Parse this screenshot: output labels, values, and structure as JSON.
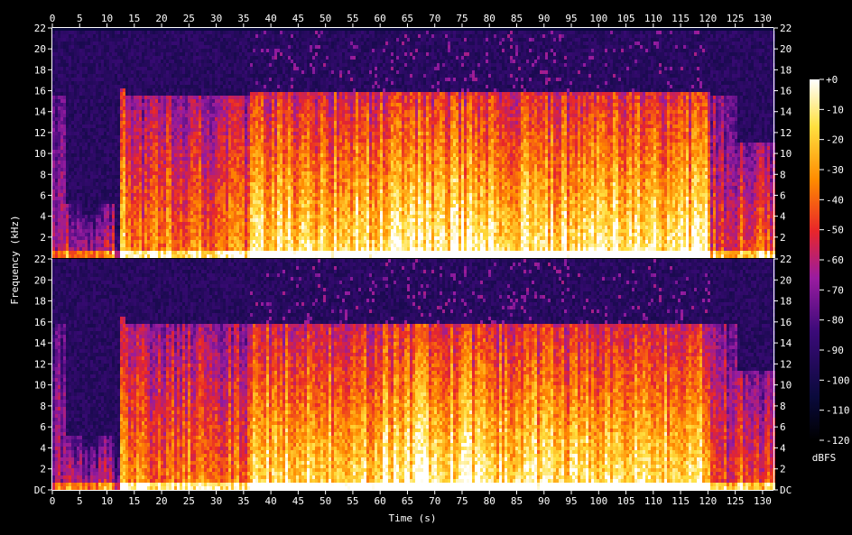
{
  "chart_data": {
    "type": "heatmap",
    "subtype": "spectrogram",
    "channels": 2,
    "xlabel": "Time (s)",
    "ylabel": "Frequency (kHz)",
    "x_range": [
      0,
      132
    ],
    "y_range": [
      0,
      22
    ],
    "x_ticks": [
      0,
      5,
      10,
      15,
      20,
      25,
      30,
      35,
      40,
      45,
      50,
      55,
      60,
      65,
      70,
      75,
      80,
      85,
      90,
      95,
      100,
      105,
      110,
      115,
      120,
      125,
      130
    ],
    "top_y_tick_labels": [
      "2",
      "4",
      "6",
      "8",
      "10",
      "12",
      "14",
      "16",
      "18",
      "20",
      "22"
    ],
    "bottom_y_tick_labels": [
      "DC",
      "2",
      "4",
      "6",
      "8",
      "10",
      "12",
      "14",
      "16",
      "18",
      "20",
      "22"
    ],
    "colorbar": {
      "label": "dBFS",
      "range": [
        -120,
        0
      ],
      "tick_labels": [
        "+0",
        "-10",
        "-20",
        "-30",
        "-40",
        "-50",
        "-60",
        "-70",
        "-80",
        "-90",
        "-100",
        "-110",
        "-120"
      ]
    },
    "segments": [
      {
        "t_start": 0,
        "t_end": 2,
        "intensity": 0.4,
        "cutoff_khz": 15.5
      },
      {
        "t_start": 2,
        "t_end": 5,
        "intensity": 0.5,
        "cutoff_khz": 5
      },
      {
        "t_start": 5,
        "t_end": 8,
        "intensity": 0.45,
        "cutoff_khz": 4
      },
      {
        "t_start": 8,
        "t_end": 11,
        "intensity": 0.55,
        "cutoff_khz": 5
      },
      {
        "t_start": 11,
        "t_end": 12,
        "intensity": 0.35,
        "cutoff_khz": 3
      },
      {
        "t_start": 12,
        "t_end": 13,
        "intensity": 0.85,
        "cutoff_khz": 16.2
      },
      {
        "t_start": 13,
        "t_end": 20,
        "intensity": 0.7,
        "cutoff_khz": 15.5
      },
      {
        "t_start": 20,
        "t_end": 26,
        "intensity": 0.72,
        "cutoff_khz": 15.5
      },
      {
        "t_start": 26,
        "t_end": 36,
        "intensity": 0.7,
        "cutoff_khz": 15.5
      },
      {
        "t_start": 36,
        "t_end": 60,
        "intensity": 0.92,
        "cutoff_khz": 15.8
      },
      {
        "t_start": 60,
        "t_end": 80,
        "intensity": 0.98,
        "cutoff_khz": 15.8
      },
      {
        "t_start": 80,
        "t_end": 95,
        "intensity": 0.93,
        "cutoff_khz": 15.8
      },
      {
        "t_start": 95,
        "t_end": 120,
        "intensity": 0.95,
        "cutoff_khz": 15.8
      },
      {
        "t_start": 120,
        "t_end": 125,
        "intensity": 0.6,
        "cutoff_khz": 15.5
      },
      {
        "t_start": 125,
        "t_end": 132,
        "intensity": 0.65,
        "cutoff_khz": 11
      }
    ],
    "colors": {
      "background": "#000000",
      "floor": "#0a0a3c",
      "mid": "#7a1ca8",
      "red": "#e8262a",
      "orange": "#ff8a00",
      "yellow": "#ffe040",
      "white": "#ffffff"
    }
  }
}
